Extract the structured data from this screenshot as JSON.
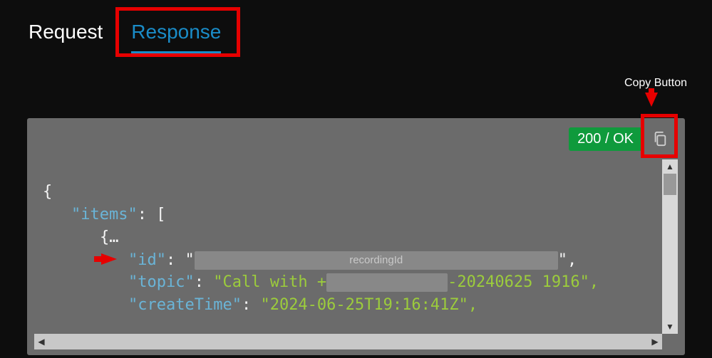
{
  "tabs": {
    "request": "Request",
    "response": "Response"
  },
  "annotations": {
    "copy_button_label": "Copy Button"
  },
  "response": {
    "status_badge": "200 / OK",
    "json": {
      "open_brace": "{",
      "items_key": "\"items\"",
      "colon_bracket": ": [",
      "inner_open": "{…",
      "id_key": "\"id\"",
      "id_colon_quote": ": \"",
      "id_redacted_label": "recordingId",
      "id_end": "\",",
      "topic_key": "\"topic\"",
      "topic_colon": ": ",
      "topic_val_pre": "\"Call with +",
      "topic_val_post": "-20240625 1916\",",
      "createTime_key": "\"createTime\"",
      "createTime_colon": ": ",
      "createTime_val": "\"2024-06-25T19:16:41Z\","
    }
  }
}
